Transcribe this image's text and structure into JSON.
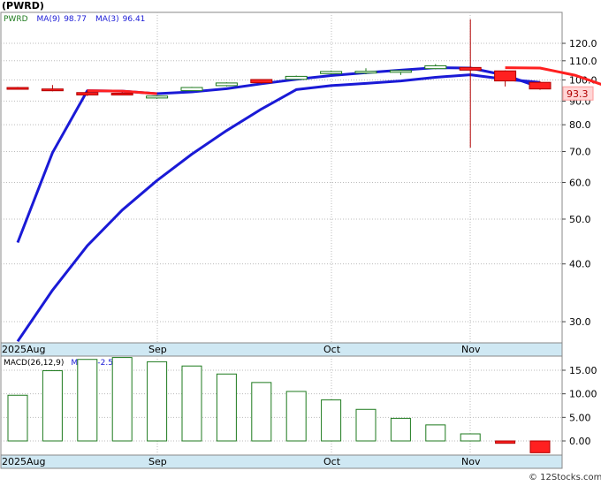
{
  "chart_data": [
    {
      "type": "candlestick",
      "title": "(PWRD)",
      "ticker_label": "PWRD",
      "indicators": [
        {
          "label": "MA(9)",
          "value": "98.77"
        },
        {
          "label": "MA(3)",
          "value": "96.41"
        }
      ],
      "yscale": "log",
      "ylim": [
        27,
        140
      ],
      "yticks": [
        {
          "value": 120,
          "label": "120.0"
        },
        {
          "value": 110,
          "label": "110.0"
        },
        {
          "value": 100,
          "label": "100.0"
        },
        {
          "value": 90,
          "label": "90.0"
        },
        {
          "value": 80,
          "label": "80.0"
        },
        {
          "value": 70,
          "label": "70.0"
        },
        {
          "value": 60,
          "label": "60.0"
        },
        {
          "value": 50,
          "label": "50.0"
        },
        {
          "value": 40,
          "label": "40.0"
        },
        {
          "value": 30,
          "label": "30.0"
        }
      ],
      "last_price_label": "93.3",
      "x_labels": [
        "2025Aug",
        "Sep",
        "Oct",
        "Nov"
      ],
      "candles": [
        {
          "week": 0,
          "open": 96.3,
          "close": 96.2,
          "high": 96.6,
          "low": 96.0
        },
        {
          "week": 1,
          "open": 95.6,
          "close": 94.8,
          "high": 97.5,
          "low": 94.5
        },
        {
          "week": 2,
          "open": 93.9,
          "close": 92.8,
          "high": 94.9,
          "low": 92.3
        },
        {
          "week": 3,
          "open": 93.6,
          "close": 93.2,
          "high": 94.1,
          "low": 92.7
        },
        {
          "week": 4,
          "open": 91.4,
          "close": 92.3,
          "high": 92.5,
          "low": 91.0
        },
        {
          "week": 5,
          "open": 94.8,
          "close": 96.3,
          "high": 96.6,
          "low": 94.6
        },
        {
          "week": 6,
          "open": 97.2,
          "close": 98.5,
          "high": 98.8,
          "low": 96.8
        },
        {
          "week": 7,
          "open": 100.2,
          "close": 98.6,
          "high": 100.4,
          "low": 98.1
        },
        {
          "week": 8,
          "open": 100.3,
          "close": 101.8,
          "high": 102.2,
          "low": 100.0
        },
        {
          "week": 9,
          "open": 103.2,
          "close": 104.3,
          "high": 104.8,
          "low": 102.8
        },
        {
          "week": 10,
          "open": 103.7,
          "close": 104.4,
          "high": 106.0,
          "low": 102.9
        },
        {
          "week": 11,
          "open": 104.3,
          "close": 104.8,
          "high": 105.2,
          "low": 102.5
        },
        {
          "week": 12,
          "open": 105.8,
          "close": 107.3,
          "high": 108.2,
          "low": 105.4
        },
        {
          "week": 13,
          "open": 106.4,
          "close": 105.0,
          "high": 135.2,
          "low": 71.4
        },
        {
          "week": 14,
          "open": 104.6,
          "close": 99.5,
          "high": 104.9,
          "low": 96.8
        },
        {
          "week": 15,
          "open": 98.8,
          "close": 95.6,
          "high": 99.3,
          "low": 95.2
        }
      ],
      "series": [
        {
          "name": "MA(9)",
          "color": "#1a1ad6",
          "start_week": 0,
          "values": [
            27.2,
            35.1,
            43.8,
            52.3,
            60.6,
            69.1,
            77.7,
            86.5,
            95.3,
            97.2,
            98.3,
            99.5,
            101.3,
            102.6,
            100.4,
            98.77
          ]
        },
        {
          "name": "MA(3)",
          "color": "#1a1ad6",
          "start_week": 0,
          "values": [
            44.5,
            69.6,
            94.8,
            94.6,
            93.4,
            94.2,
            95.7,
            98.1,
            100.3,
            102.2,
            103.7,
            105.0,
            106.3,
            106.1,
            102.4,
            96.41
          ]
        },
        {
          "name": "MA(3) weakening",
          "color": "#ff2020",
          "start_week": 2,
          "values": [
            94.8,
            94.6,
            93.4,
            null,
            null,
            null,
            null,
            null,
            null,
            null,
            null,
            null,
            106.3,
            106.1,
            102.4,
            96.41
          ]
        }
      ]
    },
    {
      "type": "bar",
      "title": "MACD(26,12,9)",
      "indicators": [
        {
          "label": "MACD:",
          "value": "-2.50"
        }
      ],
      "ylim": [
        -3,
        18
      ],
      "yticks": [
        {
          "value": 15,
          "label": "15.00"
        },
        {
          "value": 10,
          "label": "10.00"
        },
        {
          "value": 5,
          "label": "5.00"
        },
        {
          "value": 0,
          "label": "0.00"
        }
      ],
      "x_labels": [
        "2025Aug",
        "Sep",
        "Oct",
        "Nov"
      ],
      "values": [
        9.7,
        14.9,
        17.3,
        17.7,
        16.8,
        15.9,
        14.2,
        12.4,
        10.5,
        8.7,
        6.7,
        4.8,
        3.4,
        1.5,
        -0.5,
        -2.5
      ]
    }
  ],
  "footer": {
    "credit": "© 12Stocks.com"
  }
}
